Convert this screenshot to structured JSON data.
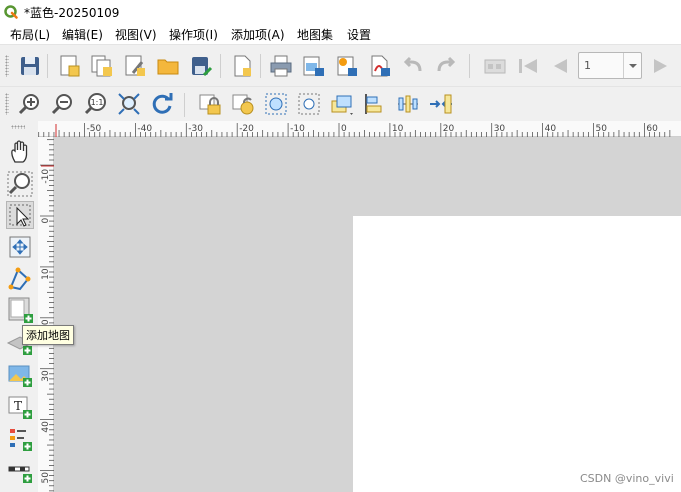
{
  "window": {
    "title": "*蓝色-20250109"
  },
  "menu": [
    "布局(L)",
    "编辑(E)",
    "视图(V)",
    "操作项(I)",
    "添加项(A)",
    "地图集",
    "设置"
  ],
  "toolbar1": {
    "icons": [
      "save-layout-icon",
      "new-layout-icon",
      "duplicate-layout-icon",
      "layout-manager-icon",
      "open-folder-icon",
      "save-template-icon",
      "new-page-icon",
      "print-icon",
      "export-image-icon",
      "export-svg-icon",
      "export-pdf-icon",
      "undo-icon",
      "redo-icon",
      "atlas-preview-icon",
      "first-feature-icon",
      "previous-feature-icon",
      "next-feature-icon"
    ],
    "atlas_page": "1"
  },
  "toolbar2": {
    "icons": [
      "zoom-in-icon",
      "zoom-out-icon",
      "zoom-actual-icon",
      "zoom-full-icon",
      "refresh-icon",
      "lock-items-icon",
      "unlock-items-icon",
      "group-items-icon",
      "ungroup-items-icon",
      "raise-items-icon",
      "align-items-icon",
      "distribute-items-icon",
      "resize-items-icon"
    ]
  },
  "left_toolbar": {
    "icons": [
      "pan-icon",
      "zoom-tool-icon",
      "select-move-icon",
      "move-content-icon",
      "edit-nodes-icon",
      "add-map-icon",
      "add-3d-map-icon",
      "add-picture-icon",
      "add-label-icon",
      "add-legend-icon",
      "add-scalebar-icon"
    ]
  },
  "ruler": {
    "h_labels": [
      "-50",
      "-40",
      "-30",
      "-20",
      "-10",
      "0",
      "10",
      "20",
      "30",
      "40",
      "50",
      "60"
    ],
    "v_labels": [
      "-10",
      "0",
      "10",
      "20",
      "30",
      "40",
      "50"
    ]
  },
  "tooltip": {
    "text": "添加地图"
  },
  "watermark": "CSDN @vino_vivi",
  "colors": {
    "canvas": "#d4d4d4",
    "page": "#ffffff",
    "accent": "#2f6fb6",
    "add-badge": "#2e9e3f"
  }
}
